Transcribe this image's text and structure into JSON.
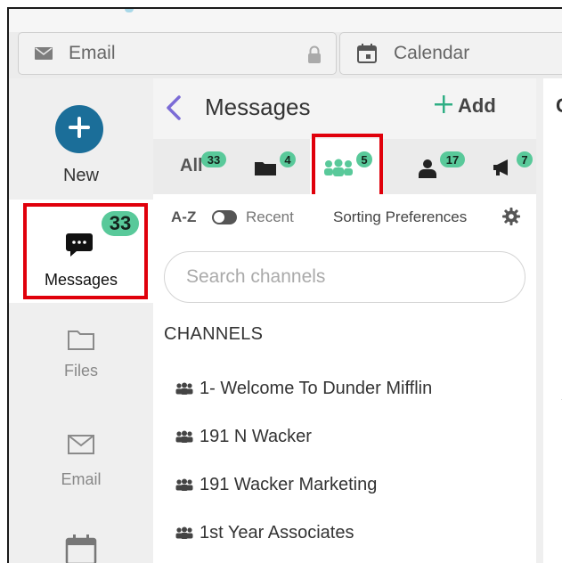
{
  "tabs": {
    "email_label": "Email",
    "calendar_label": "Calendar"
  },
  "leftnav": {
    "new_label": "New",
    "messages_label": "Messages",
    "messages_badge": "33",
    "files_label": "Files",
    "email_label": "Email"
  },
  "panel": {
    "title": "Messages",
    "add_label": "Add",
    "filters": {
      "all_label": "All",
      "all_count": "33",
      "folders_count": "4",
      "channels_count": "5",
      "people_count": "17",
      "announcements_count": "7"
    },
    "sort": {
      "az_label": "A-Z",
      "recent_label": "Recent",
      "preferences_label": "Sorting Preferences"
    },
    "search_placeholder": "Search channels",
    "section_title": "CHANNELS",
    "channels": [
      "1- Welcome To Dunder Mifflin",
      "191 N Wacker",
      "191 Wacker Marketing",
      "1st Year Associates"
    ]
  },
  "rightpane": {
    "letter": "C"
  },
  "colors": {
    "accent_blue": "#1b6e99",
    "badge_green": "#59c99a",
    "add_green": "#2fae84",
    "back_purple": "#7b6bd6",
    "highlight_red": "#e0000b"
  }
}
